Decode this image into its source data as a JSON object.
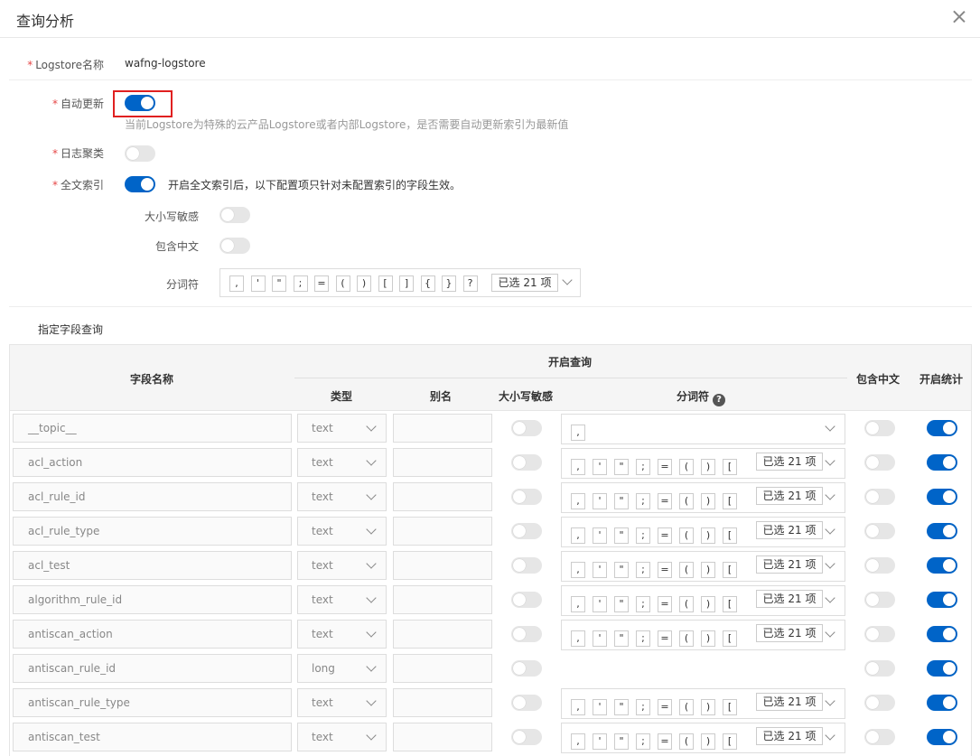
{
  "dialog": {
    "title": "查询分析"
  },
  "form": {
    "logstore_label": "Logstore名称",
    "logstore_value": "wafng-logstore",
    "auto_update_label": "自动更新",
    "auto_update_on": true,
    "auto_update_hint": "当前Logstore为特殊的云产品Logstore或者内部Logstore，是否需要自动更新索引为最新值",
    "log_cluster_label": "日志聚类",
    "log_cluster_on": false,
    "fulltext_label": "全文索引",
    "fulltext_on": true,
    "fulltext_hint": "开启全文索引后，以下配置项只针对未配置索引的字段生效。",
    "case_sensitive_label": "大小写敏感",
    "case_sensitive_on": false,
    "include_chinese_label": "包含中文",
    "include_chinese_on": false,
    "delimiter_label": "分词符",
    "delimiters": [
      ",",
      "'",
      "\"",
      ";",
      "=",
      "(",
      ")",
      "[",
      "]",
      "{",
      "}",
      "?"
    ],
    "delimiter_selected": "已选 21 项"
  },
  "fields_section": {
    "title": "指定字段查询",
    "headers": {
      "field_name": "字段名称",
      "enable_query": "开启查询",
      "type": "类型",
      "alias": "别名",
      "case_sensitive": "大小写敏感",
      "delimiter": "分词符",
      "include_chinese": "包含中文",
      "enable_stats": "开启统计"
    },
    "row_tokens": [
      ",",
      "'",
      "\"",
      ";",
      "=",
      "(",
      ")",
      "["
    ],
    "rows": [
      {
        "name": "__topic__",
        "type": "text",
        "tokens": "single",
        "single_token": ",",
        "selected": "",
        "case": false,
        "chinese": false,
        "stats": true
      },
      {
        "name": "acl_action",
        "type": "text",
        "tokens": "full",
        "selected": "已选 21 项",
        "case": false,
        "chinese": false,
        "stats": true
      },
      {
        "name": "acl_rule_id",
        "type": "text",
        "tokens": "full",
        "selected": "已选 21 项",
        "case": false,
        "chinese": false,
        "stats": true
      },
      {
        "name": "acl_rule_type",
        "type": "text",
        "tokens": "full",
        "selected": "已选 21 项",
        "case": false,
        "chinese": false,
        "stats": true
      },
      {
        "name": "acl_test",
        "type": "text",
        "tokens": "full",
        "selected": "已选 21 项",
        "case": false,
        "chinese": false,
        "stats": true
      },
      {
        "name": "algorithm_rule_id",
        "type": "text",
        "tokens": "full",
        "selected": "已选 21 项",
        "case": false,
        "chinese": false,
        "stats": true
      },
      {
        "name": "antiscan_action",
        "type": "text",
        "tokens": "full",
        "selected": "已选 21 项",
        "case": false,
        "chinese": false,
        "stats": true
      },
      {
        "name": "antiscan_rule_id",
        "type": "long",
        "tokens": "none",
        "selected": "",
        "case": false,
        "chinese": false,
        "stats": true
      },
      {
        "name": "antiscan_rule_type",
        "type": "text",
        "tokens": "full",
        "selected": "已选 21 项",
        "case": false,
        "chinese": false,
        "stats": true
      },
      {
        "name": "antiscan_test",
        "type": "text",
        "tokens": "full",
        "selected": "已选 21 项",
        "case": false,
        "chinese": false,
        "stats": true
      }
    ]
  },
  "colors": {
    "switch_on": "#0064c8",
    "switch_off": "#e6e6e6",
    "highlight": "#e02020",
    "required": "#e54545"
  }
}
